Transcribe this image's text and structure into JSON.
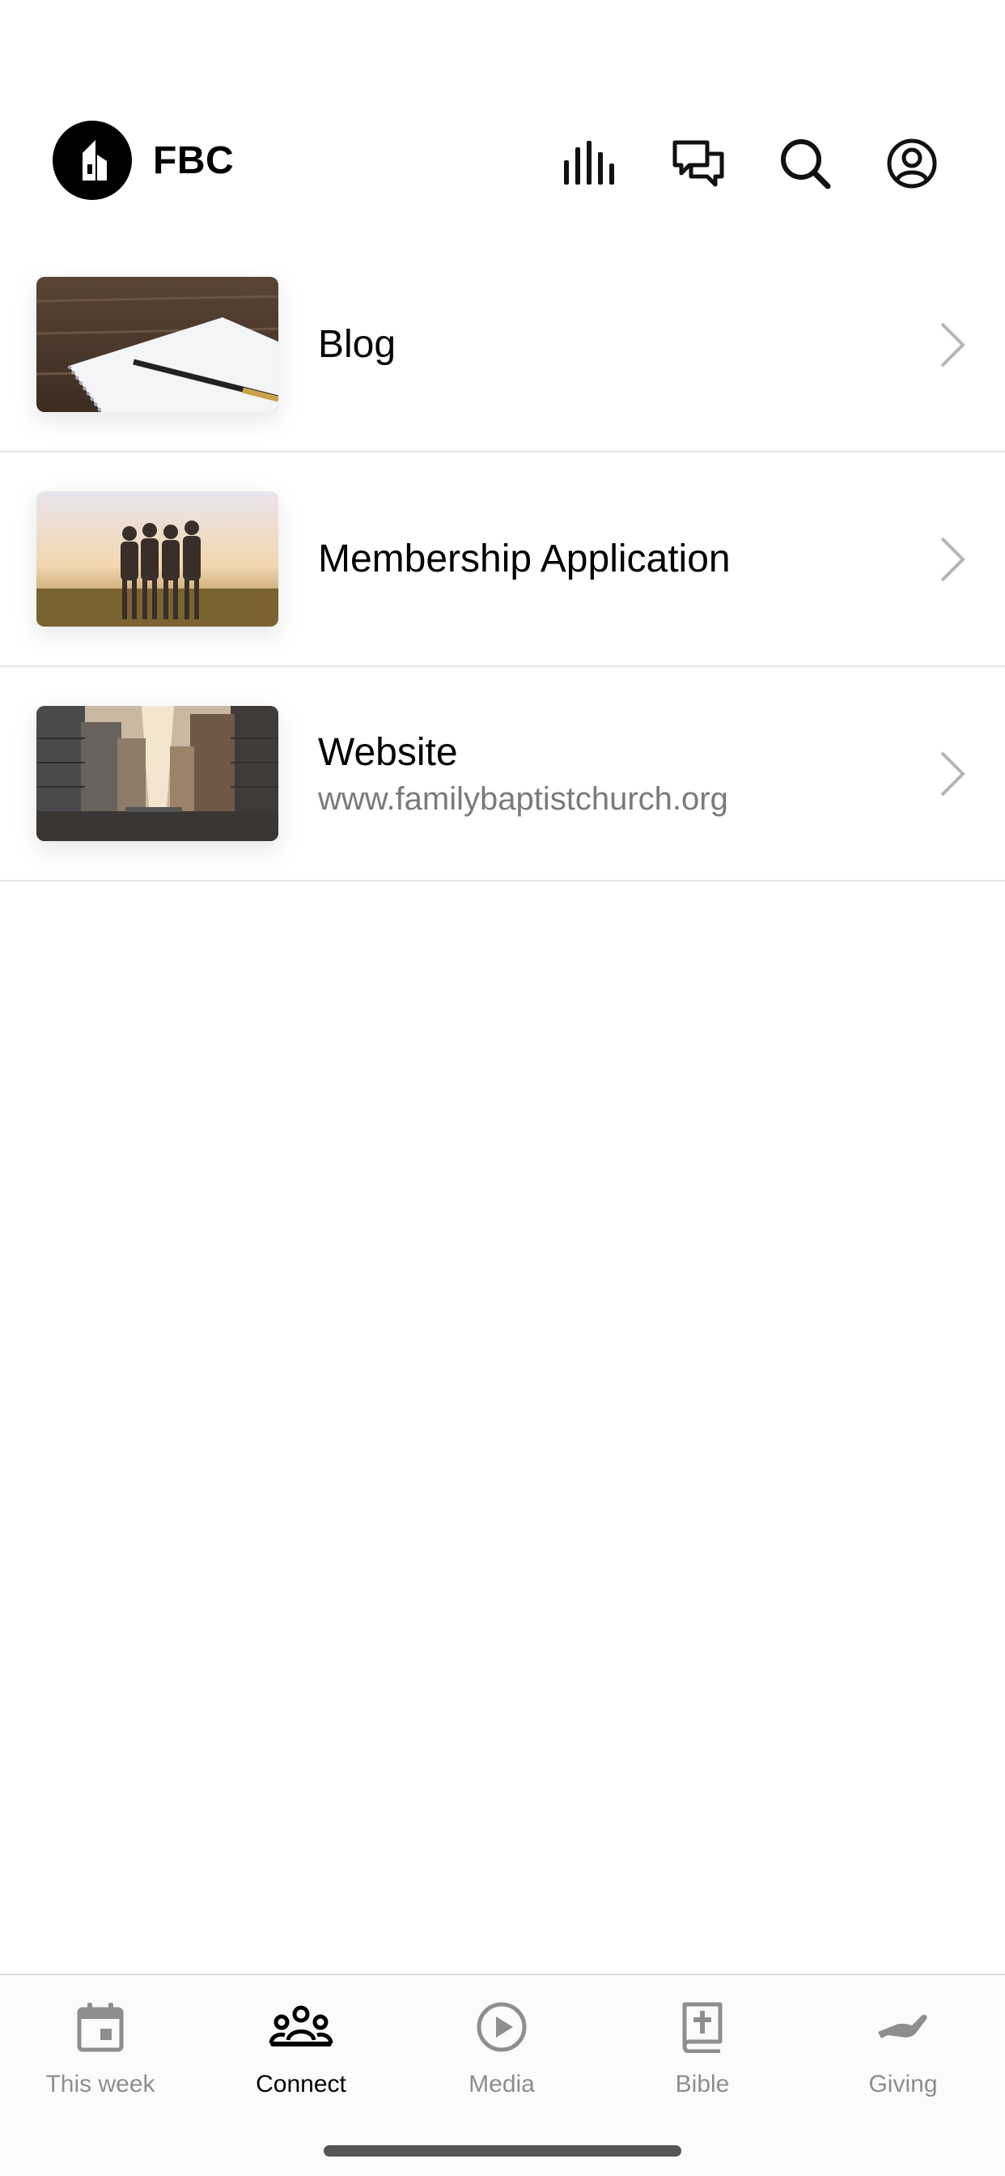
{
  "header": {
    "brand": "FBC",
    "icons": [
      "audio-bars-icon",
      "chat-icon",
      "search-icon",
      "profile-icon"
    ]
  },
  "list": [
    {
      "title": "Blog",
      "subtitle": ""
    },
    {
      "title": "Membership Application",
      "subtitle": ""
    },
    {
      "title": "Website",
      "subtitle": "www.familybaptistchurch.org"
    }
  ],
  "tabs": [
    {
      "label": "This week"
    },
    {
      "label": "Connect"
    },
    {
      "label": "Media"
    },
    {
      "label": "Bible"
    },
    {
      "label": "Giving"
    }
  ],
  "colors": {
    "active_tab": "#000000",
    "inactive_tab": "#8e8e8e",
    "subtitle": "#7a7a7a"
  }
}
